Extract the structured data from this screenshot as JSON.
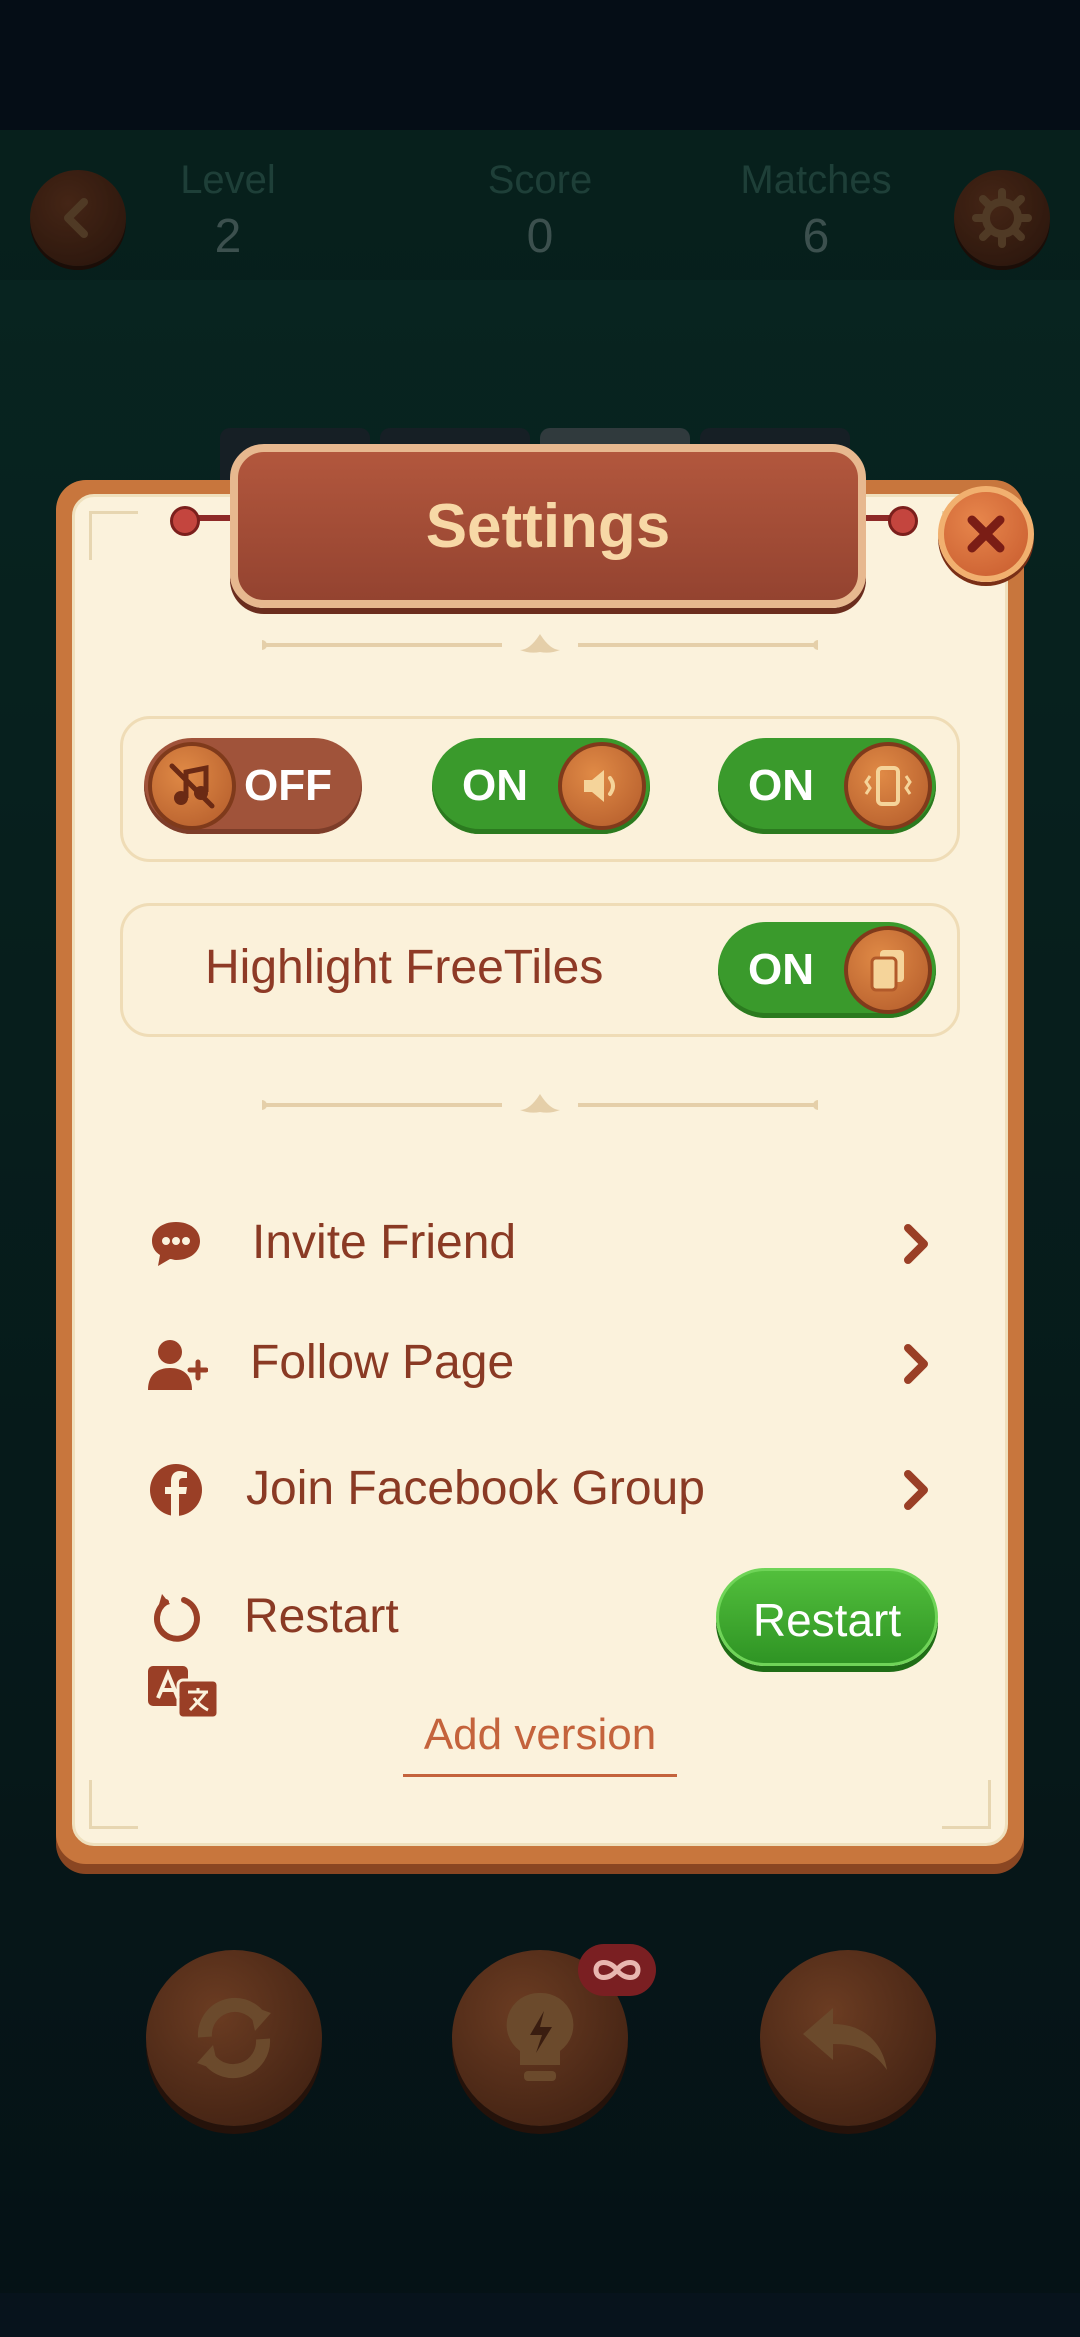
{
  "header": {
    "level_label": "Level",
    "level_value": "2",
    "score_label": "Score",
    "score_value": "0",
    "matches_label": "Matches",
    "matches_value": "6",
    "back_icon": "chevron-left-icon",
    "settings_icon": "gear-icon"
  },
  "dialog": {
    "title": "Settings",
    "close_icon": "close-icon",
    "toggles": [
      {
        "name": "music",
        "state": "OFF",
        "icon": "music-off-icon"
      },
      {
        "name": "sound",
        "state": "ON",
        "icon": "speaker-icon"
      },
      {
        "name": "vibration",
        "state": "ON",
        "icon": "vibrate-icon"
      }
    ],
    "highlight": {
      "label": "Highlight FreeTiles",
      "state": "ON",
      "icon": "tiles-icon"
    },
    "menu": [
      {
        "label": "Invite Friend",
        "icon": "chat-bubble-icon"
      },
      {
        "label": "Follow Page",
        "icon": "add-user-icon"
      },
      {
        "label": "Join Facebook Group",
        "icon": "facebook-icon"
      }
    ],
    "restart": {
      "label": "Restart",
      "button_label": "Restart",
      "icon": "restart-icon"
    },
    "language_icon": "translate-icon",
    "add_version": "Add version"
  },
  "bottom_bar": {
    "shuffle_icon": "shuffle-icon",
    "hint_icon": "lightbulb-icon",
    "hint_badge_icon": "infinity-icon",
    "undo_icon": "undo-icon"
  },
  "colors": {
    "panel": "#fbf2dc",
    "accent_brown": "#8a3a24",
    "toggle_on": "#3a9a2c",
    "toggle_off": "#a0533a",
    "title_plate": "#a34d36"
  }
}
